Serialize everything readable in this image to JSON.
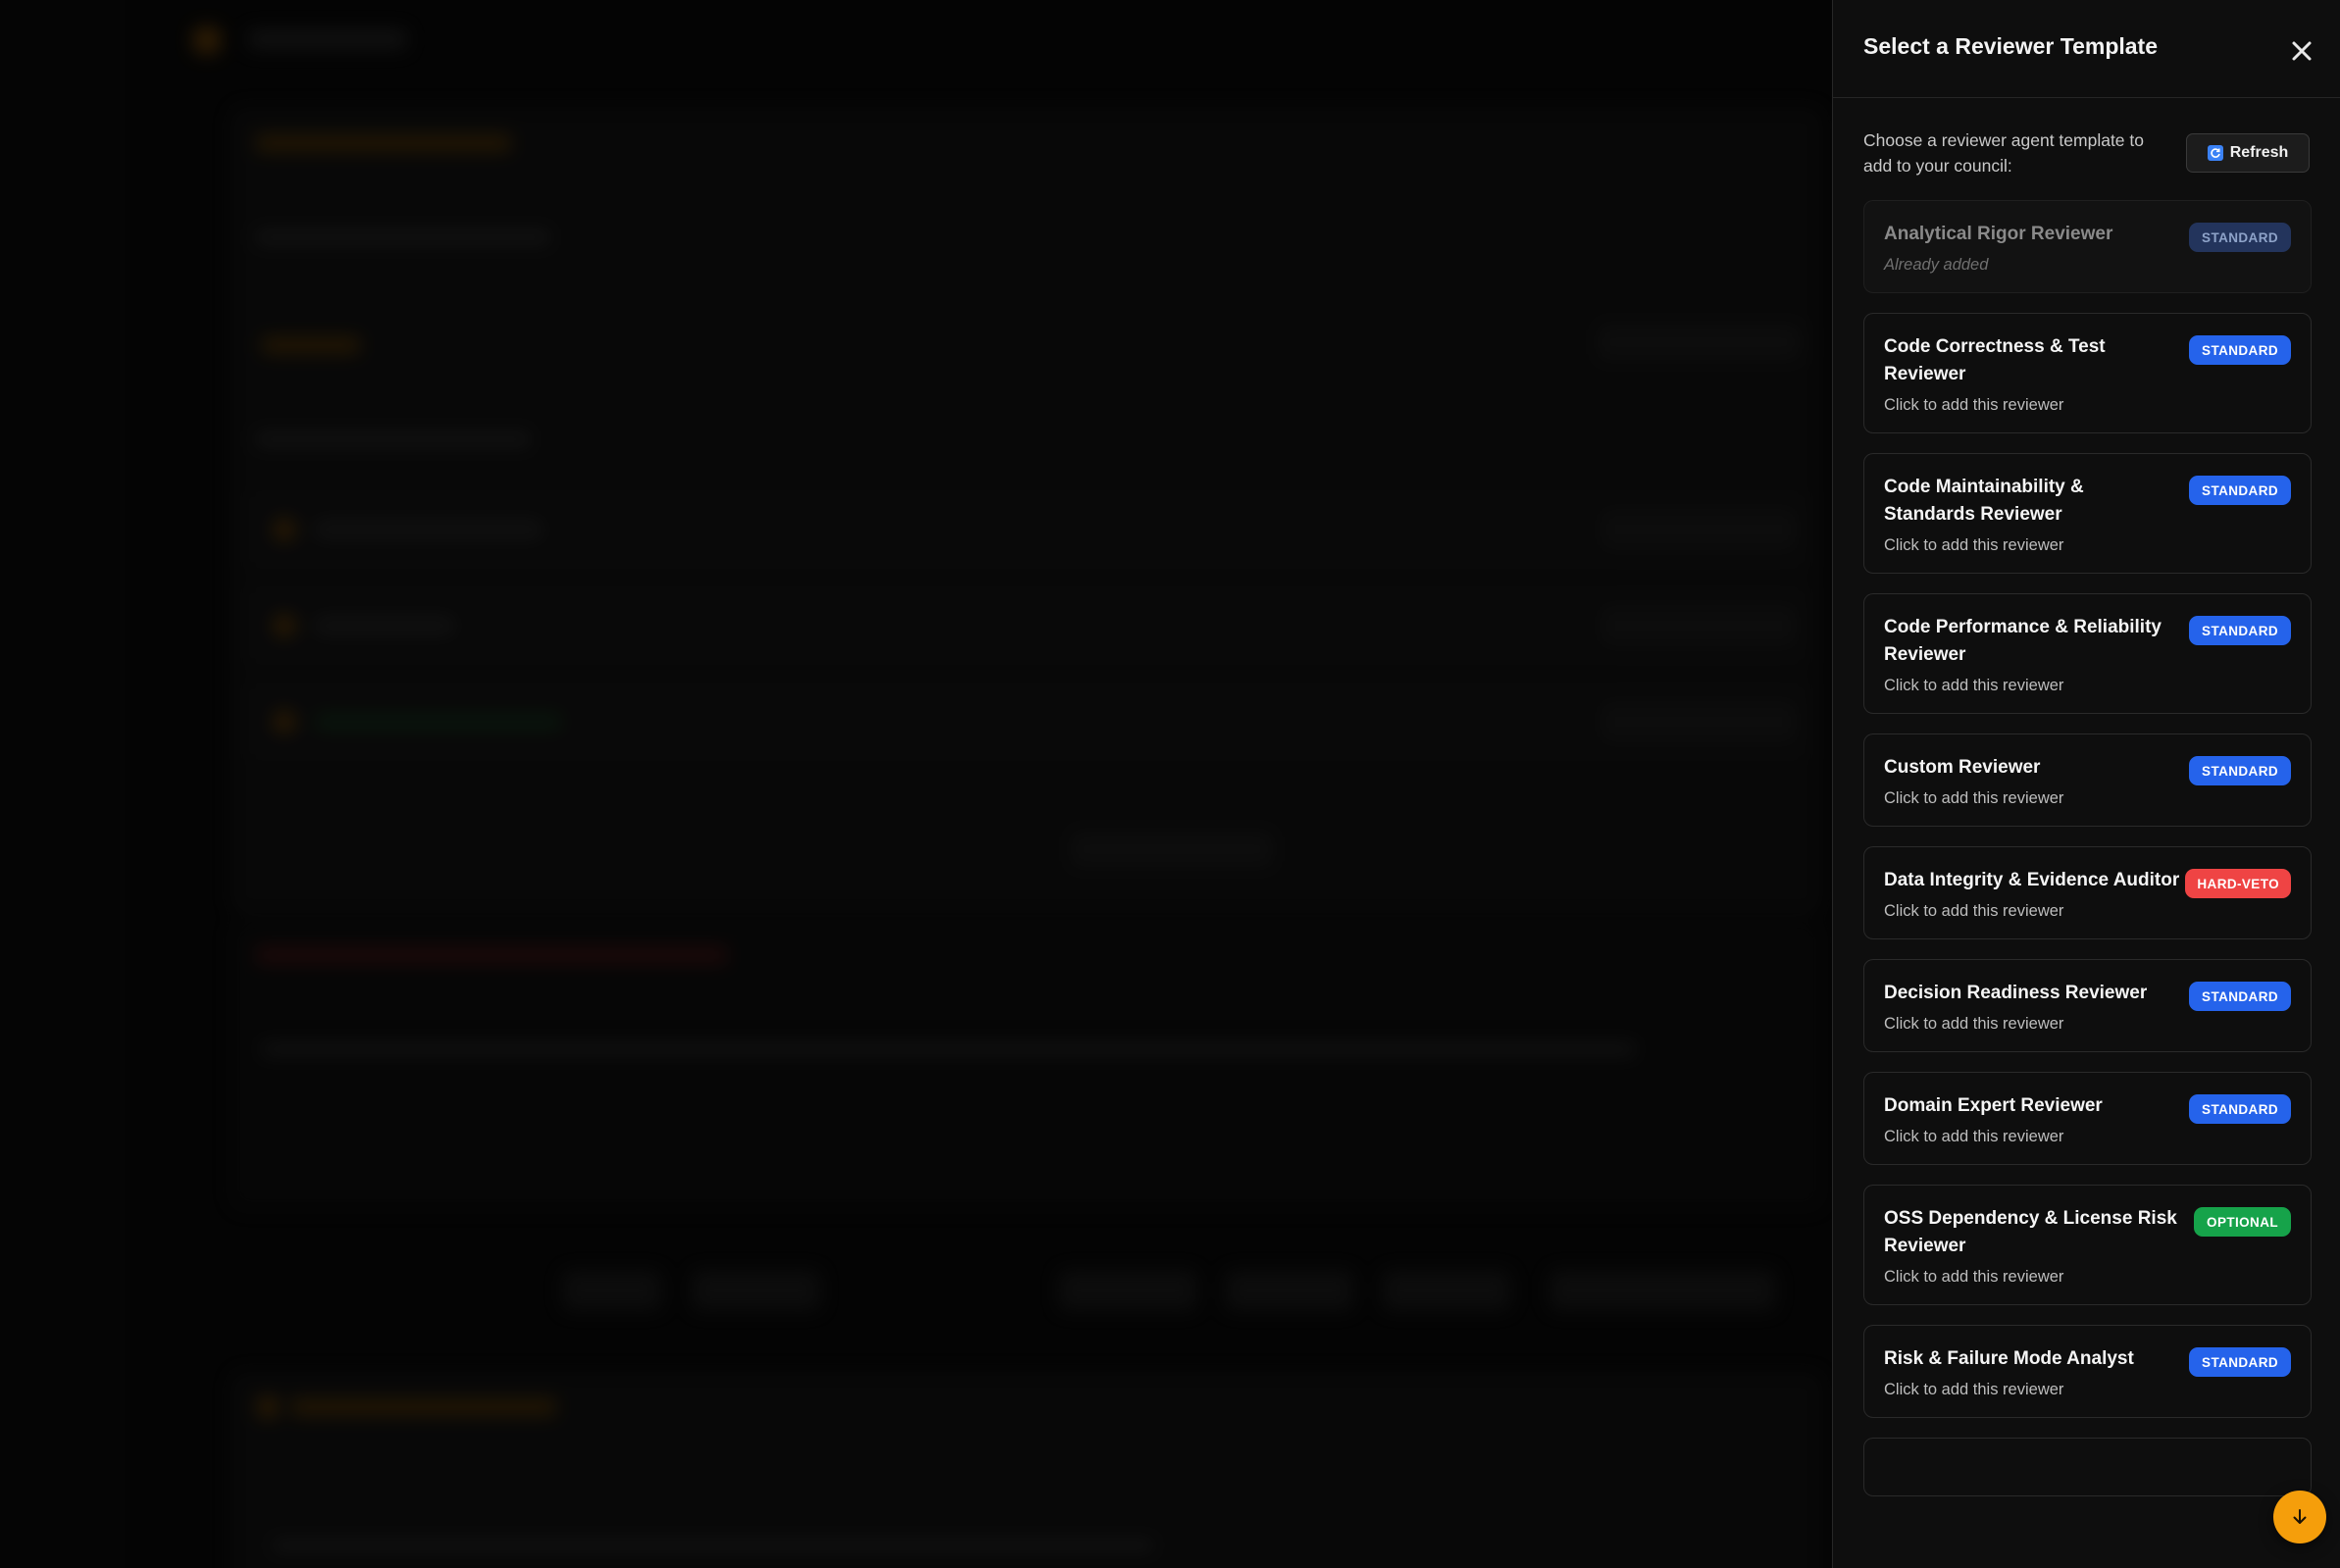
{
  "drawer": {
    "title": "Select a Reviewer Template",
    "intro": "Choose a reviewer agent template to add to your council:",
    "refresh_label": "Refresh"
  },
  "templates": [
    {
      "name": "Analytical Rigor Reviewer",
      "badge": "STANDARD",
      "status": "Already added",
      "variant": "standard",
      "added": true
    },
    {
      "name": "Code Correctness & Test Reviewer",
      "badge": "STANDARD",
      "status": "Click to add this reviewer",
      "variant": "standard",
      "added": false
    },
    {
      "name": "Code Maintainability & Standards Reviewer",
      "badge": "STANDARD",
      "status": "Click to add this reviewer",
      "variant": "standard",
      "added": false
    },
    {
      "name": "Code Performance & Reliability Reviewer",
      "badge": "STANDARD",
      "status": "Click to add this reviewer",
      "variant": "standard",
      "added": false
    },
    {
      "name": "Custom Reviewer",
      "badge": "STANDARD",
      "status": "Click to add this reviewer",
      "variant": "standard",
      "added": false
    },
    {
      "name": "Data Integrity & Evidence Auditor",
      "badge": "HARD-VETO",
      "status": "Click to add this reviewer",
      "variant": "hard-veto",
      "added": false
    },
    {
      "name": "Decision Readiness Reviewer",
      "badge": "STANDARD",
      "status": "Click to add this reviewer",
      "variant": "standard",
      "added": false
    },
    {
      "name": "Domain Expert Reviewer",
      "badge": "STANDARD",
      "status": "Click to add this reviewer",
      "variant": "standard",
      "added": false
    },
    {
      "name": "OSS Dependency & License Risk Reviewer",
      "badge": "OPTIONAL",
      "status": "Click to add this reviewer",
      "variant": "optional",
      "added": false
    },
    {
      "name": "Risk & Failure Mode Analyst",
      "badge": "STANDARD",
      "status": "Click to add this reviewer",
      "variant": "standard",
      "added": false
    }
  ],
  "colors": {
    "accent": "#f59e0b",
    "standard": "#2563eb",
    "hard_veto": "#ef4444",
    "optional": "#16a34a"
  },
  "icons": {
    "close": "close-icon",
    "refresh": "refresh-icon",
    "scroll_down": "arrow-down-icon"
  }
}
